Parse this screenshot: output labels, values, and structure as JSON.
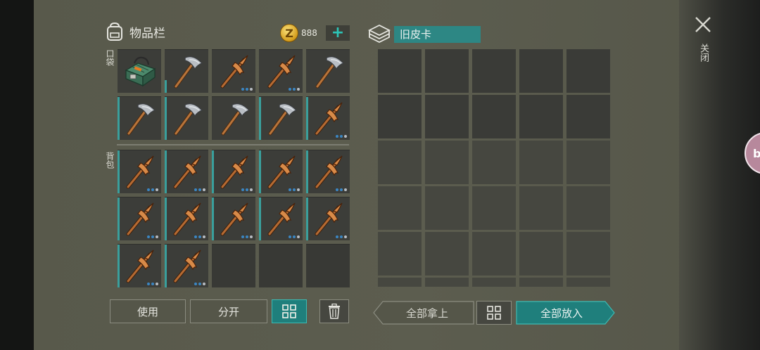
{
  "inventory": {
    "title": "物品栏",
    "coins": "888",
    "add_symbol": "+"
  },
  "sections": {
    "pocket": "口袋",
    "backpack": "背包"
  },
  "chest": {
    "name": "旧皮卡"
  },
  "buttons": {
    "use": "使用",
    "split": "分开",
    "take_all": "全部拿上",
    "put_all": "全部放入"
  },
  "close_label": "关闭",
  "coin_symbol": "Z",
  "floating_badge": "bi",
  "pocket_slots": [
    {
      "item": "toolbox",
      "bar": "none",
      "dots": 0
    },
    {
      "item": "stone-pickaxe",
      "bar": "short",
      "dots": 0
    },
    {
      "item": "copper-pickaxe",
      "bar": "none",
      "dots": 3
    },
    {
      "item": "copper-pickaxe",
      "bar": "none",
      "dots": 3
    },
    {
      "item": "stone-pickaxe",
      "bar": "none",
      "dots": 0
    },
    {
      "item": "stone-pickaxe",
      "bar": "full",
      "dots": 0
    },
    {
      "item": "stone-pickaxe",
      "bar": "full",
      "dots": 0
    },
    {
      "item": "stone-pickaxe",
      "bar": "none",
      "dots": 0
    },
    {
      "item": "stone-pickaxe",
      "bar": "full",
      "dots": 0
    },
    {
      "item": "copper-pickaxe",
      "bar": "full",
      "dots": 3
    }
  ],
  "backpack_slots": [
    {
      "item": "copper-pickaxe",
      "bar": "full",
      "dots": 3
    },
    {
      "item": "copper-pickaxe",
      "bar": "full",
      "dots": 3
    },
    {
      "item": "copper-pickaxe",
      "bar": "full",
      "dots": 3
    },
    {
      "item": "copper-pickaxe",
      "bar": "full",
      "dots": 3
    },
    {
      "item": "copper-pickaxe",
      "bar": "full",
      "dots": 3
    },
    {
      "item": "copper-pickaxe",
      "bar": "full",
      "dots": 3
    },
    {
      "item": "copper-pickaxe",
      "bar": "full",
      "dots": 3
    },
    {
      "item": "copper-pickaxe",
      "bar": "full",
      "dots": 3
    },
    {
      "item": "copper-pickaxe",
      "bar": "full",
      "dots": 3
    },
    {
      "item": "copper-pickaxe",
      "bar": "full",
      "dots": 3
    },
    {
      "item": "copper-pickaxe",
      "bar": "full",
      "dots": 3
    },
    {
      "item": "copper-pickaxe",
      "bar": "full",
      "dots": 3
    },
    {
      "item": "empty"
    },
    {
      "item": "empty"
    },
    {
      "item": "empty"
    }
  ]
}
